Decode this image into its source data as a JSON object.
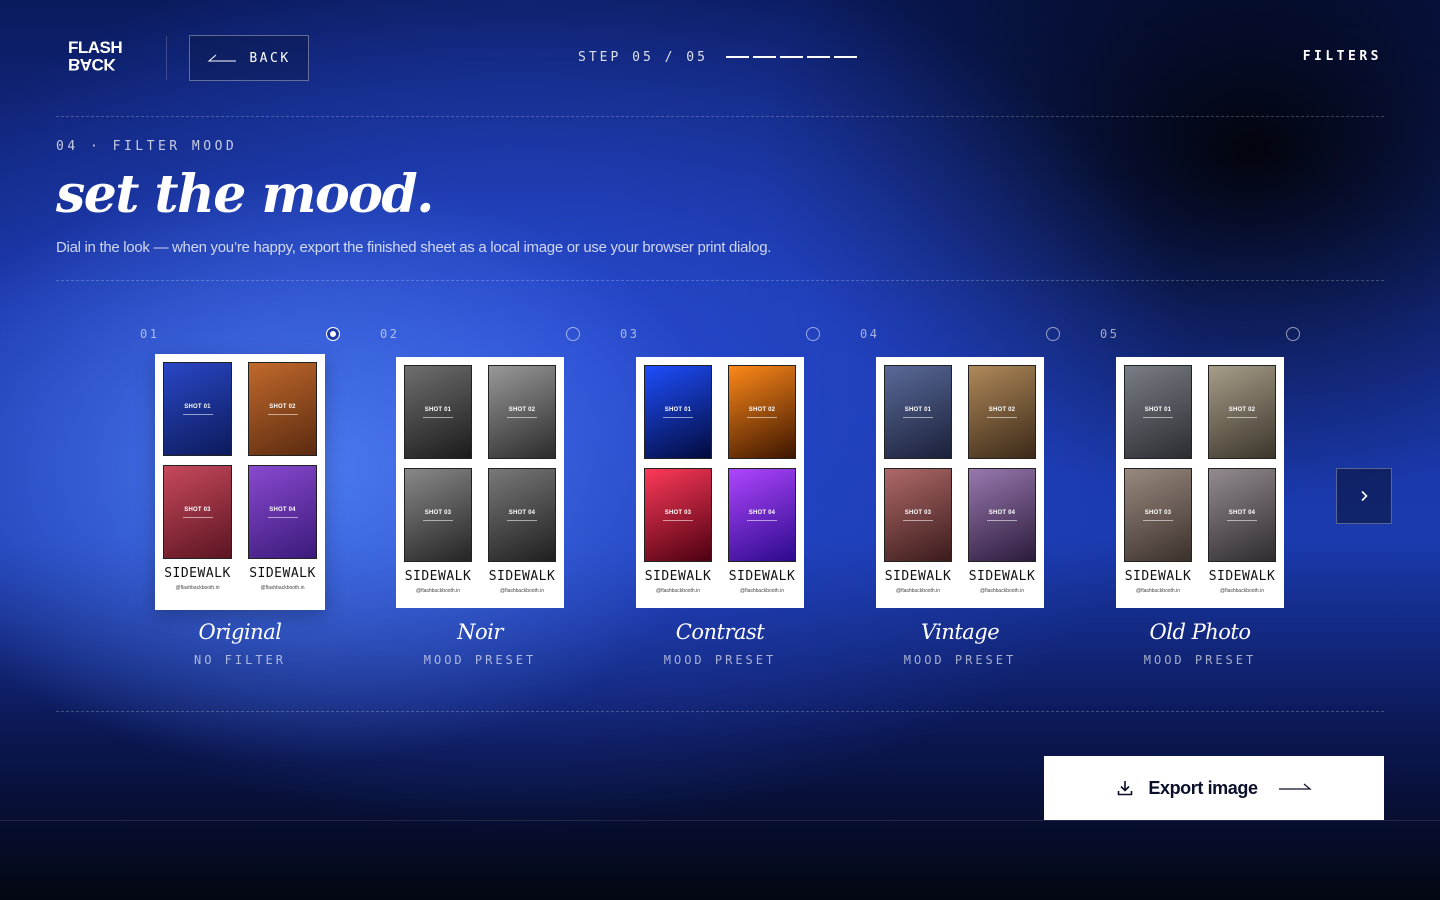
{
  "header": {
    "logo_top": "FLASH",
    "logo_bottom": "BACK",
    "back_label": "BACK",
    "step_text": "STEP 05 / 05",
    "step_current": 5,
    "step_total": 5,
    "filters_label": "FILTERS"
  },
  "section": {
    "eyebrow": "04 · FILTER MOOD",
    "title": "set the mood.",
    "subtitle": "Dial in the look — when you’re happy, export the finished sheet as a local image or use your browser print dialog."
  },
  "sheet": {
    "shots": [
      "SHOT 01",
      "SHOT 02",
      "SHOT 03",
      "SHOT 04"
    ],
    "brand": "SIDEWALK",
    "handle": "@flashbackbooth.in"
  },
  "filters": [
    {
      "num": "01",
      "name": "Original",
      "sub": "NO FILTER",
      "selected": true,
      "colors": [
        [
          "#2a48c8",
          "#0c1a5a"
        ],
        [
          "#c26a2c",
          "#5a2a10"
        ],
        [
          "#c84a5e",
          "#5a1420"
        ],
        [
          "#8a4ad0",
          "#3a1a7a"
        ]
      ]
    },
    {
      "num": "02",
      "name": "Noir",
      "sub": "MOOD PRESET",
      "selected": false,
      "colors": [
        [
          "#707070",
          "#1a1a1a"
        ],
        [
          "#9a9a9a",
          "#2a2a2a"
        ],
        [
          "#8a8a8a",
          "#232323"
        ],
        [
          "#7a7a7a",
          "#1e1e1e"
        ]
      ]
    },
    {
      "num": "03",
      "name": "Contrast",
      "sub": "MOOD PRESET",
      "selected": false,
      "colors": [
        [
          "#1f4fff",
          "#020a3a"
        ],
        [
          "#ff8a1a",
          "#3a1400"
        ],
        [
          "#ff3a5a",
          "#4a0010"
        ],
        [
          "#b046ff",
          "#2a0a8a"
        ]
      ]
    },
    {
      "num": "04",
      "name": "Vintage",
      "sub": "MOOD PRESET",
      "selected": false,
      "colors": [
        [
          "#5a6a9a",
          "#1a2038"
        ],
        [
          "#b08a5a",
          "#3a2818"
        ],
        [
          "#b06a6a",
          "#3a1a1a"
        ],
        [
          "#9a7ab0",
          "#2a1a3a"
        ]
      ]
    },
    {
      "num": "05",
      "name": "Old Photo",
      "sub": "MOOD PRESET",
      "selected": false,
      "colors": [
        [
          "#7a7e86",
          "#2a2c30"
        ],
        [
          "#a89e8a",
          "#3a342a"
        ],
        [
          "#9a8a80",
          "#3a302a"
        ],
        [
          "#948c92",
          "#2e2a2e"
        ]
      ]
    }
  ],
  "next_icon": "chevron-right-icon",
  "export": {
    "label": "Export image",
    "icon": "download-icon"
  }
}
